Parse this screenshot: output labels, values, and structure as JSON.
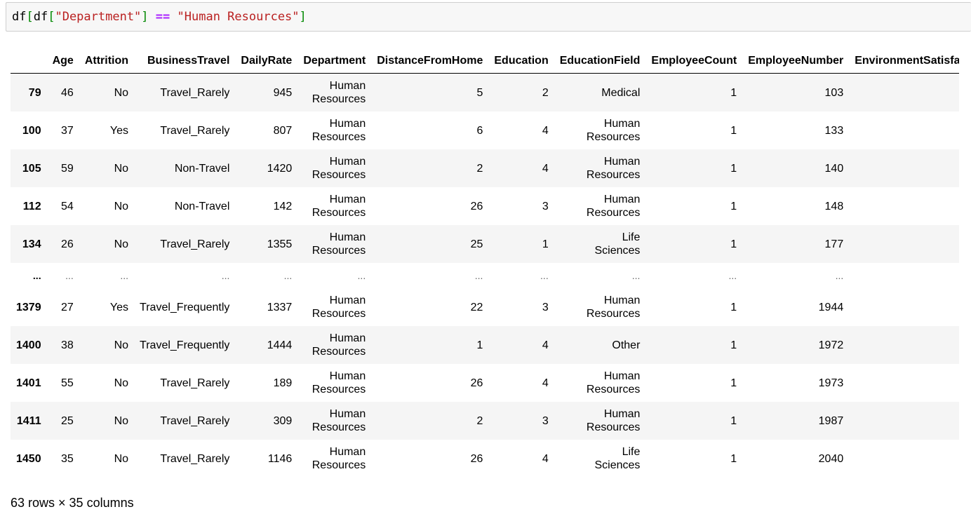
{
  "code_cell": {
    "tokens": [
      {
        "text": "df",
        "kind": "name"
      },
      {
        "text": "[",
        "kind": "brk"
      },
      {
        "text": "df",
        "kind": "name"
      },
      {
        "text": "[",
        "kind": "brk"
      },
      {
        "text": "\"Department\"",
        "kind": "str"
      },
      {
        "text": "]",
        "kind": "brk"
      },
      {
        "text": " ",
        "kind": "name"
      },
      {
        "text": "==",
        "kind": "op"
      },
      {
        "text": " ",
        "kind": "name"
      },
      {
        "text": "\"Human Resources\"",
        "kind": "str"
      },
      {
        "text": "]",
        "kind": "brk"
      }
    ]
  },
  "table": {
    "columns": [
      "",
      "Age",
      "Attrition",
      "BusinessTravel",
      "DailyRate",
      "Department",
      "DistanceFromHome",
      "Education",
      "EducationField",
      "EmployeeCount",
      "EmployeeNumber",
      "EnvironmentSatisfaction"
    ],
    "rows": [
      {
        "index": "79",
        "cells": [
          "46",
          "No",
          "Travel_Rarely",
          "945",
          "Human Resources",
          "5",
          "2",
          "Medical",
          "1",
          "103",
          ""
        ]
      },
      {
        "index": "100",
        "cells": [
          "37",
          "Yes",
          "Travel_Rarely",
          "807",
          "Human Resources",
          "6",
          "4",
          "Human Resources",
          "1",
          "133",
          ""
        ]
      },
      {
        "index": "105",
        "cells": [
          "59",
          "No",
          "Non-Travel",
          "1420",
          "Human Resources",
          "2",
          "4",
          "Human Resources",
          "1",
          "140",
          ""
        ]
      },
      {
        "index": "112",
        "cells": [
          "54",
          "No",
          "Non-Travel",
          "142",
          "Human Resources",
          "26",
          "3",
          "Human Resources",
          "1",
          "148",
          ""
        ]
      },
      {
        "index": "134",
        "cells": [
          "26",
          "No",
          "Travel_Rarely",
          "1355",
          "Human Resources",
          "25",
          "1",
          "Life Sciences",
          "1",
          "177",
          ""
        ]
      },
      {
        "index": "...",
        "ellipsis": true,
        "cells": [
          "...",
          "...",
          "...",
          "...",
          "...",
          "...",
          "...",
          "...",
          "...",
          "...",
          ""
        ]
      },
      {
        "index": "1379",
        "cells": [
          "27",
          "Yes",
          "Travel_Frequently",
          "1337",
          "Human Resources",
          "22",
          "3",
          "Human Resources",
          "1",
          "1944",
          ""
        ]
      },
      {
        "index": "1400",
        "cells": [
          "38",
          "No",
          "Travel_Frequently",
          "1444",
          "Human Resources",
          "1",
          "4",
          "Other",
          "1",
          "1972",
          ""
        ]
      },
      {
        "index": "1401",
        "cells": [
          "55",
          "No",
          "Travel_Rarely",
          "189",
          "Human Resources",
          "26",
          "4",
          "Human Resources",
          "1",
          "1973",
          ""
        ]
      },
      {
        "index": "1411",
        "cells": [
          "25",
          "No",
          "Travel_Rarely",
          "309",
          "Human Resources",
          "2",
          "3",
          "Human Resources",
          "1",
          "1987",
          ""
        ]
      },
      {
        "index": "1450",
        "cells": [
          "35",
          "No",
          "Travel_Rarely",
          "1146",
          "Human Resources",
          "26",
          "4",
          "Life Sciences",
          "1",
          "2040",
          ""
        ]
      }
    ]
  },
  "shape_caption": "63 rows × 35 columns",
  "colors": {
    "code_bg": "#f7f7f7",
    "string": "#ba2121",
    "operator": "#aa22ff",
    "bracket": "#008800",
    "row_stripe": "#f5f5f5"
  }
}
